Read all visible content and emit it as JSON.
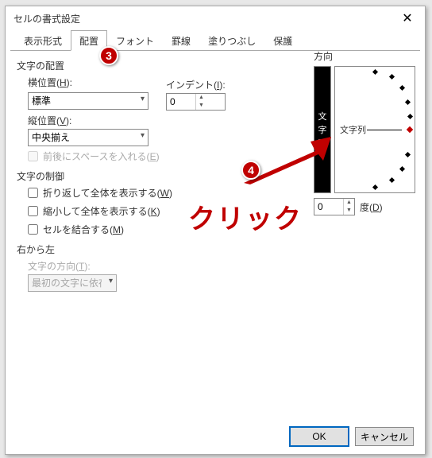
{
  "title": "セルの書式設定",
  "tabs": [
    "表示形式",
    "配置",
    "フォント",
    "罫線",
    "塗りつぶし",
    "保護"
  ],
  "activeTab": 1,
  "align": {
    "group": "文字の配置",
    "horizLabel": "横位置(H):",
    "horizValue": "標準",
    "indentLabel": "インデント(I):",
    "indentValue": "0",
    "vertLabel": "縦位置(V):",
    "vertValue": "中央揃え",
    "distributedChk": "前後にスペースを入れる(E)"
  },
  "control": {
    "group": "文字の制御",
    "wrap": "折り返して全体を表示する(W)",
    "shrink": "縮小して全体を表示する(K)",
    "merge": "セルを結合する(M)"
  },
  "rtl": {
    "group": "右から左",
    "dirLabel": "文字の方向(T):",
    "dirValue": "最初の文字に依存"
  },
  "orientation": {
    "group": "方向",
    "vertBtn": "文字列",
    "dialText": "文字列",
    "degValue": "0",
    "degLabel": "度(D)"
  },
  "buttons": {
    "ok": "OK",
    "cancel": "キャンセル"
  },
  "annotations": {
    "badge3": "3",
    "badge4": "4",
    "clickText": "クリック"
  }
}
